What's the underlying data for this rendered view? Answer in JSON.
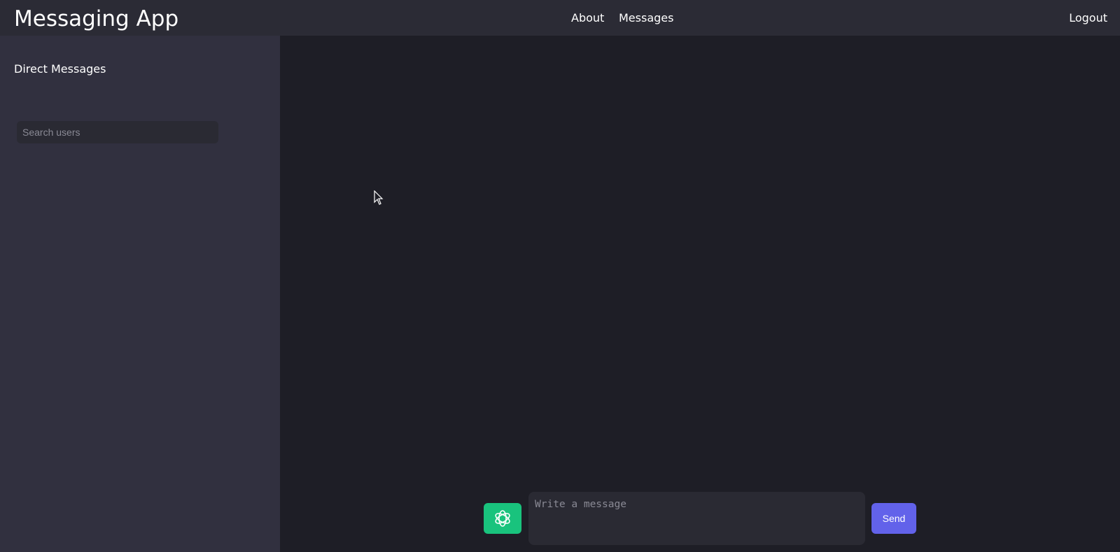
{
  "navbar": {
    "brand": "Messaging App",
    "links": {
      "about": "About",
      "messages": "Messages",
      "logout": "Logout"
    }
  },
  "sidebar": {
    "title": "Direct Messages",
    "search": {
      "placeholder": "Search users",
      "value": ""
    }
  },
  "composer": {
    "ai_icon": "openai-logo-icon",
    "input_placeholder": "Write a message",
    "input_value": "",
    "send_label": "Send"
  },
  "colors": {
    "navbar_bg": "#2b2b35",
    "sidebar_bg": "#31303f",
    "chat_bg": "#1e1e26",
    "ai_button": "#19c37d",
    "send_button": "#6262ea"
  }
}
